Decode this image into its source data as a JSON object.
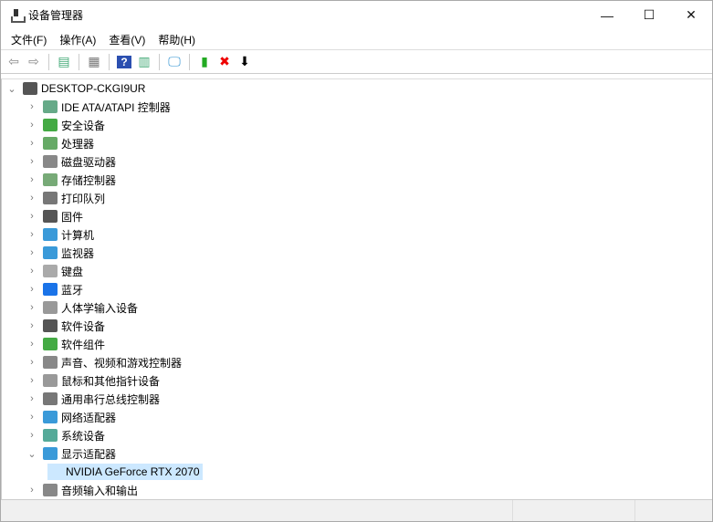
{
  "window": {
    "title": "设备管理器",
    "minimize": "—",
    "maximize": "☐",
    "close": "✕"
  },
  "menu": [
    "文件(F)",
    "操作(A)",
    "查看(V)",
    "帮助(H)"
  ],
  "toolbar": [
    {
      "icon": "back-icon",
      "glyph": "⇦",
      "color": "#888"
    },
    {
      "icon": "forward-icon",
      "glyph": "⇨",
      "color": "#888"
    },
    {
      "sep": true
    },
    {
      "icon": "show-hide-console-tree-icon",
      "glyph": "▤",
      "color": "#4a7"
    },
    {
      "sep": true
    },
    {
      "icon": "properties-icon",
      "glyph": "▦",
      "color": "#777"
    },
    {
      "sep": true
    },
    {
      "icon": "help-icon",
      "glyph": "?",
      "color": "#fff",
      "bg": "#2b4fb0"
    },
    {
      "icon": "action-pane-icon",
      "glyph": "▥",
      "color": "#4a7"
    },
    {
      "sep": true
    },
    {
      "icon": "scan-hardware-icon",
      "glyph": "🖵",
      "color": "#2a8fd0"
    },
    {
      "sep": true
    },
    {
      "icon": "update-driver-icon",
      "glyph": "▮",
      "color": "#2a2"
    },
    {
      "icon": "uninstall-icon",
      "glyph": "✖",
      "color": "#e00"
    },
    {
      "icon": "disable-device-icon",
      "glyph": "⬇",
      "color": "#000"
    }
  ],
  "tree": {
    "root": "DESKTOP-CKGI9UR",
    "categories": [
      {
        "label": "IDE ATA/ATAPI 控制器",
        "color": "#6a8"
      },
      {
        "label": "安全设备",
        "color": "#4a4"
      },
      {
        "label": "处理器",
        "color": "#6a6"
      },
      {
        "label": "磁盘驱动器",
        "color": "#888"
      },
      {
        "label": "存储控制器",
        "color": "#7a7"
      },
      {
        "label": "打印队列",
        "color": "#777"
      },
      {
        "label": "固件",
        "color": "#555"
      },
      {
        "label": "计算机",
        "color": "#3a9ad9"
      },
      {
        "label": "监视器",
        "color": "#3a9ad9"
      },
      {
        "label": "键盘",
        "color": "#aaa"
      },
      {
        "label": "蓝牙",
        "color": "#1a73e8"
      },
      {
        "label": "人体学输入设备",
        "color": "#999"
      },
      {
        "label": "软件设备",
        "color": "#555"
      },
      {
        "label": "软件组件",
        "color": "#4a4"
      },
      {
        "label": "声音、视频和游戏控制器",
        "color": "#888"
      },
      {
        "label": "鼠标和其他指针设备",
        "color": "#999"
      },
      {
        "label": "通用串行总线控制器",
        "color": "#777"
      },
      {
        "label": "网络适配器",
        "color": "#3a9ad9"
      },
      {
        "label": "系统设备",
        "color": "#5a9"
      },
      {
        "label": "显示适配器",
        "color": "#3a9ad9",
        "expanded": true
      }
    ],
    "selected_child": "NVIDIA GeForce RTX 2070",
    "last": {
      "label": "音频输入和输出",
      "color": "#888"
    }
  }
}
